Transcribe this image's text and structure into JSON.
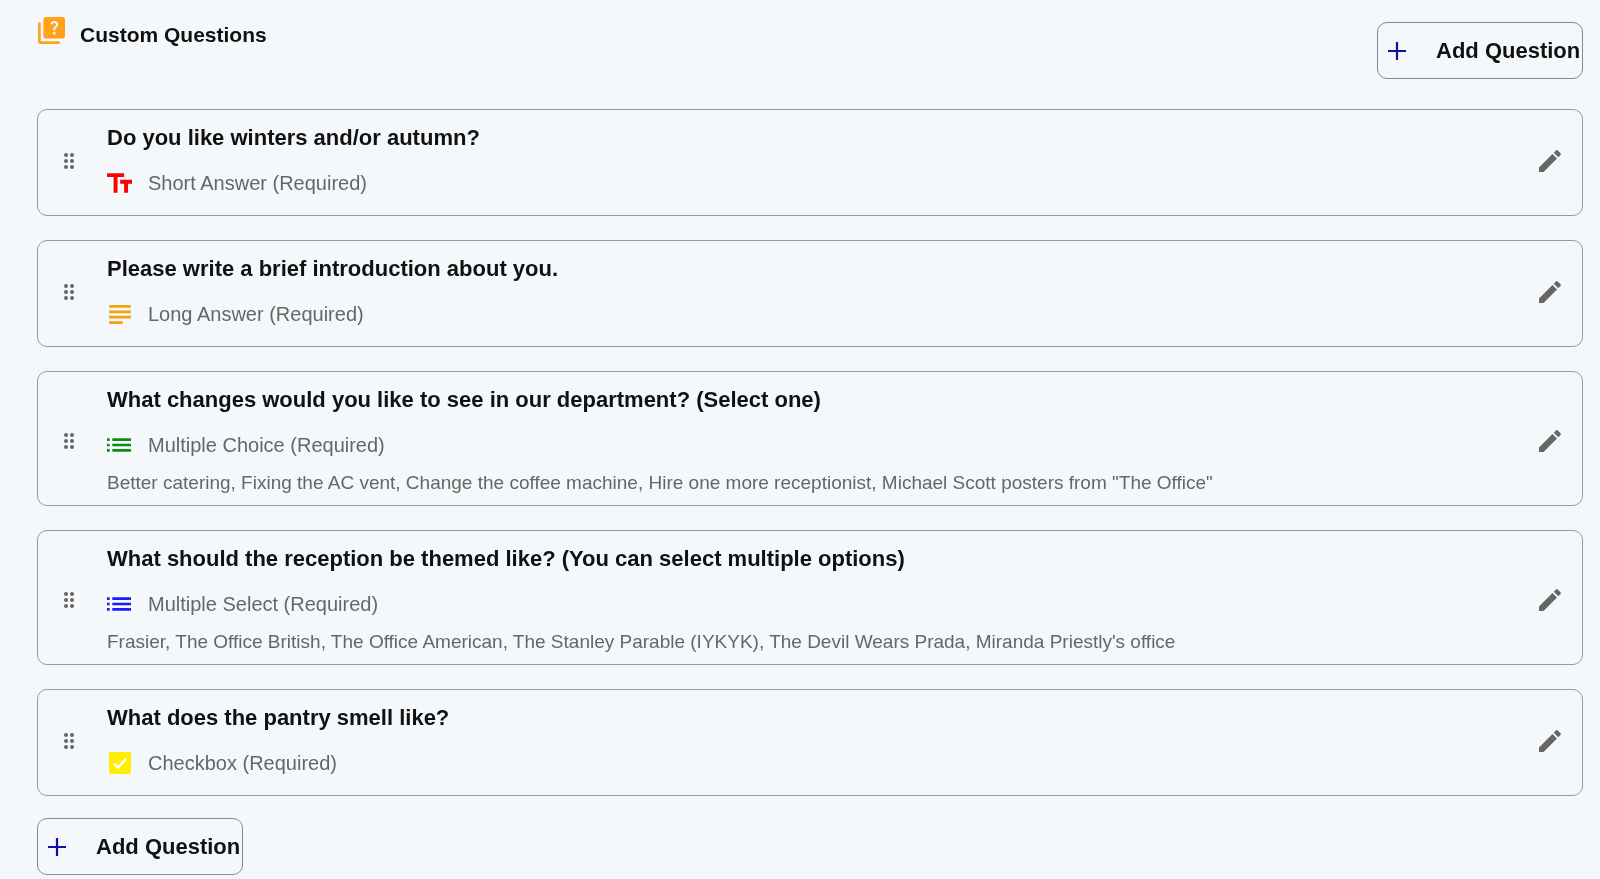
{
  "header": {
    "title": "Custom Questions",
    "add_button": {
      "label": "Add Question"
    }
  },
  "questions": [
    {
      "text": "Do you like winters and/or autumn?",
      "kind": "short_answer",
      "type_label": "Short Answer (Required)"
    },
    {
      "text": "Please write a brief introduction about you.",
      "kind": "long_answer",
      "type_label": "Long Answer (Required)"
    },
    {
      "text": "What changes would you like to see in our department? (Select one)",
      "kind": "multiple_choice",
      "type_label": "Multiple Choice (Required)",
      "options": "Better catering, Fixing the AC vent, Change the coffee machine, Hire one more receptionist, Michael Scott posters from \"The Office\""
    },
    {
      "text": "What should the reception be themed like? (You can select multiple options)",
      "kind": "multiple_select",
      "type_label": "Multiple Select (Required)",
      "options": "Frasier, The Office British, The Office American, The Stanley Parable (IYKYK), The Devil Wears Prada, Miranda Priestly's office"
    },
    {
      "text": "What does the pantry smell like?",
      "kind": "checkbox",
      "type_label": "Checkbox (Required)"
    }
  ],
  "footer": {
    "add_button": {
      "label": "Add Question"
    }
  }
}
